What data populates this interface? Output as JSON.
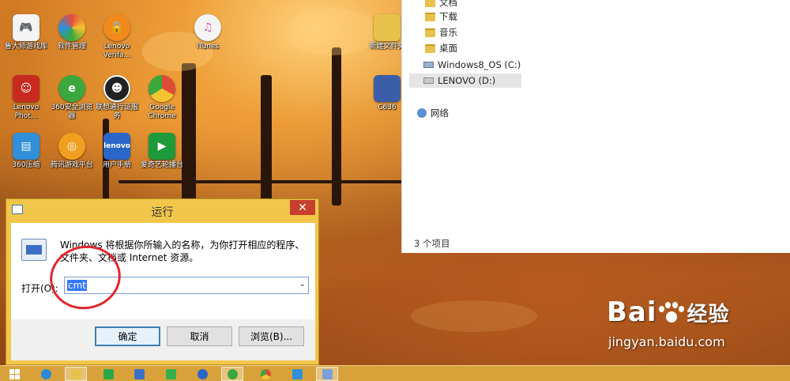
{
  "desktop": {
    "icons": [
      {
        "label": "鲁大师游戏库",
        "icon": "gamepad-icon",
        "color": "#ffffff"
      },
      {
        "label": "软件管理",
        "icon": "colorful-ball-icon",
        "color": "#e84a3c"
      },
      {
        "label": "Lenovo Verifa...",
        "icon": "lock-icon",
        "color": "#f08a1c"
      },
      {
        "label": "iTunes",
        "icon": "music-note-icon",
        "color": "#e05aa8"
      },
      {
        "label": "Lenovo Phot...",
        "icon": "photo-person-icon",
        "color": "#c82a1e"
      },
      {
        "label": "360安全浏览器",
        "icon": "browser-e-icon",
        "color": "#3aa83c"
      },
      {
        "label": "联想通行证服务",
        "icon": "user-badge-icon",
        "color": "#222222"
      },
      {
        "label": "Google Chrome",
        "icon": "chrome-icon",
        "color": "#dd4b39"
      },
      {
        "label": "360压缩",
        "icon": "archive-icon",
        "color": "#2f8fd8"
      },
      {
        "label": "腾讯游戏平台",
        "icon": "game-platform-icon",
        "color": "#f0a020"
      },
      {
        "label": "用户手册",
        "icon": "monitor-icon",
        "color": "#2a66c8"
      },
      {
        "label": "爱奇艺轮播台",
        "icon": "tv-icon",
        "color": "#1e9a3a"
      },
      {
        "label": "新建文件夹",
        "icon": "folder-icon",
        "color": "#e8c14c"
      },
      {
        "label": "C636",
        "icon": "book-icon",
        "color": "#3a5ea8"
      }
    ]
  },
  "explorer": {
    "nav_items": [
      {
        "label": "文档",
        "icon": "folder-icon"
      },
      {
        "label": "下载",
        "icon": "folder-icon"
      },
      {
        "label": "音乐",
        "icon": "folder-icon"
      },
      {
        "label": "桌面",
        "icon": "folder-icon"
      },
      {
        "label": "Windows8_OS (C:)",
        "icon": "drive-icon"
      },
      {
        "label": "LENOVO (D:)",
        "icon": "drive-icon"
      },
      {
        "label": "网络",
        "icon": "network-icon"
      }
    ],
    "status": "3 个项目"
  },
  "run_dialog": {
    "title": "运行",
    "close": "✕",
    "description": "Windows 将根据你所输入的名称，为你打开相应的程序、文件夹、文档或 Internet 资源。",
    "open_label": "打开(O):",
    "input_value": "cmt",
    "buttons": {
      "ok": "确定",
      "cancel": "取消",
      "browse": "浏览(B)..."
    }
  },
  "taskbar": {
    "items": [
      {
        "icon": "windows-start-icon",
        "color": "#ffffff"
      },
      {
        "icon": "ie-icon",
        "color": "#2a8ad8"
      },
      {
        "icon": "file-explorer-icon",
        "color": "#e8c14c"
      },
      {
        "icon": "store-icon",
        "color": "#2aa84a"
      },
      {
        "icon": "media-icon",
        "color": "#3a6fc4"
      },
      {
        "icon": "game-center-icon",
        "color": "#35b04a"
      },
      {
        "icon": "k-icon",
        "color": "#2a66c8"
      },
      {
        "icon": "360-browser-icon",
        "color": "#3aa83c"
      },
      {
        "icon": "chrome-icon",
        "color": "#dd4b39"
      },
      {
        "icon": "bird-icon",
        "color": "#2f8fd8"
      },
      {
        "icon": "run-window-icon",
        "color": "#7aa0d8"
      }
    ]
  },
  "watermark": {
    "brand": "Bai",
    "brand_suffix": "经验",
    "url": "jingyan.baidu.com"
  }
}
